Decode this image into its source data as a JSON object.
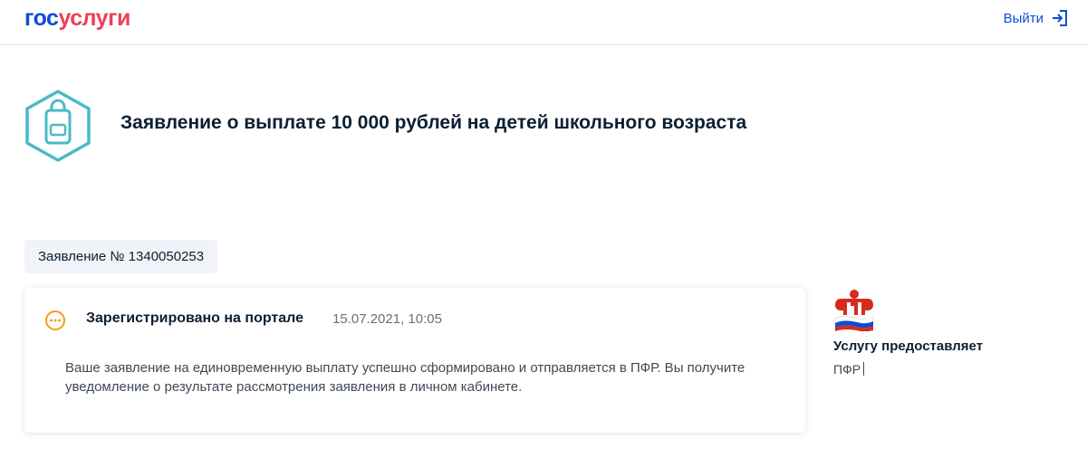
{
  "header": {
    "logo_part1": "гос",
    "logo_part2": "услуги",
    "logout_label": "Выйти"
  },
  "service": {
    "icon": "backpack-icon",
    "title": "Заявление о выплате 10 000 рублей на детей школьного возраста"
  },
  "application": {
    "number_label": "Заявление № 1340050253"
  },
  "status": {
    "icon": "pending-dots-icon",
    "title": "Зарегистрировано на портале",
    "date": "15.07.2021, 10:05",
    "message": "Ваше заявление на единовременную выплату успешно сформировано и отправляется в ПФР. Вы получите уведомление о результате рассмотрения заявления в личном кабинете."
  },
  "provider": {
    "logo": "pfr-logo",
    "caption": "Услугу предоставляет",
    "name": "ПФР"
  },
  "colors": {
    "brand_blue": "#0d4cd3",
    "brand_red": "#ee3f58",
    "icon_teal": "#4bb9c8",
    "status_orange": "#f59c1c"
  }
}
